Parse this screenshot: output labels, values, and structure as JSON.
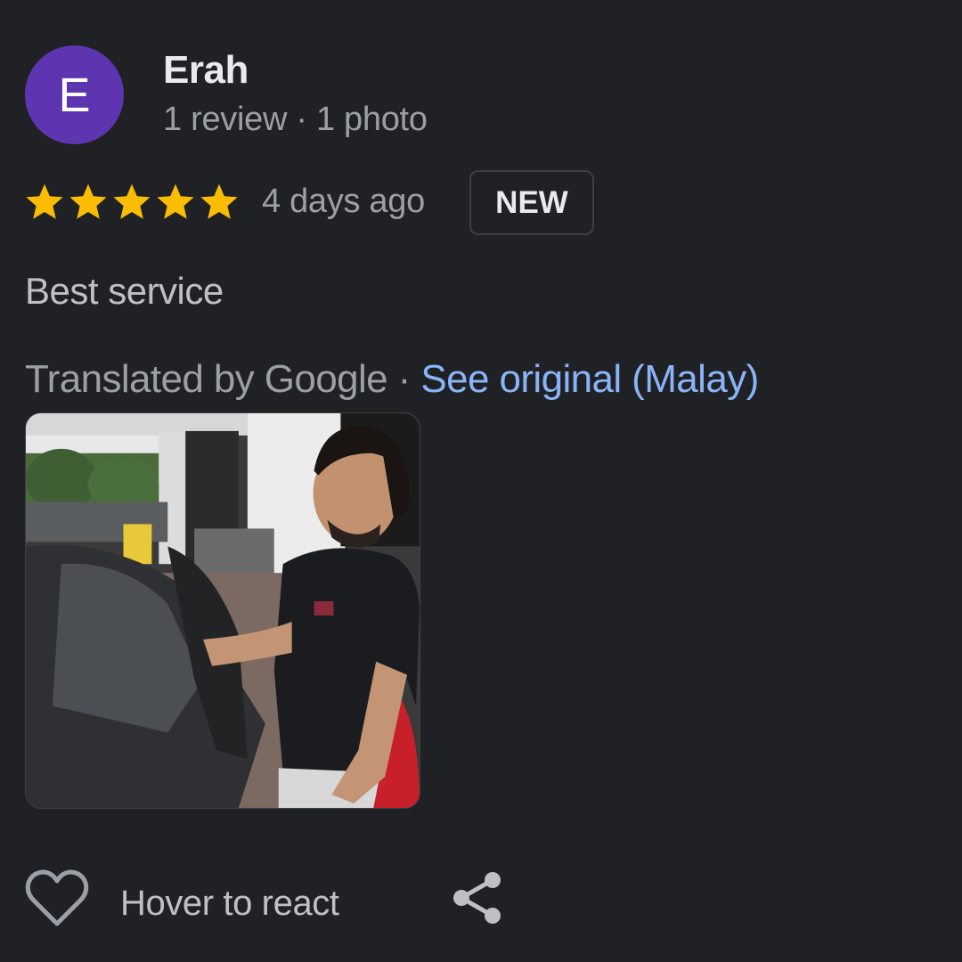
{
  "reviewer": {
    "avatar_letter": "E",
    "avatar_color": "#5e35b1",
    "name": "Erah",
    "meta": "1 review · 1 photo"
  },
  "rating": {
    "stars": 5,
    "max": 5,
    "star_color": "#fbbc04"
  },
  "date": "4 days ago",
  "badge": "NEW",
  "review_text": "Best service",
  "translation": {
    "by": "Translated by Google",
    "separator": " · ",
    "link": "See original (Malay)",
    "link_color": "#8ab4f8"
  },
  "actions": {
    "react_icon": "heart-icon",
    "react_label": "Hover to react",
    "share_icon": "share-icon"
  }
}
